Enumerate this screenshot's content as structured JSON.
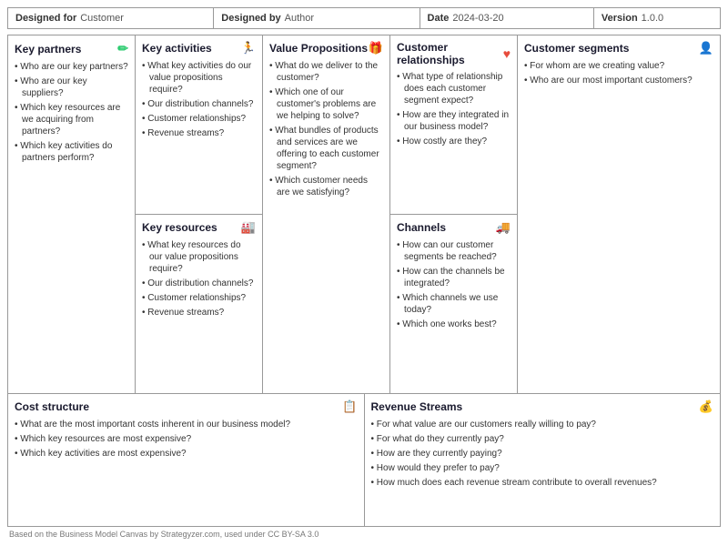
{
  "header": {
    "designed_for_label": "Designed for",
    "designed_for_value": "Customer",
    "designed_by_label": "Designed by",
    "designed_by_value": "Author",
    "date_label": "Date",
    "date_value": "2024-03-20",
    "version_label": "Version",
    "version_value": "1.0.0"
  },
  "sections": {
    "key_partners": {
      "title": "Key partners",
      "icon": "✏",
      "icon_color": "green",
      "bullets": [
        "Who are our key partners?",
        "Who are our key suppliers?",
        "Which key resources are we acquiring from partners?",
        "Which key activities do partners perform?"
      ]
    },
    "key_activities": {
      "title": "Key activities",
      "icon": "🏃",
      "icon_color": "blue-dark",
      "bullets": [
        "What key activities do our value propositions require?",
        "Our distribution channels?",
        "Customer relationships?",
        "Revenue streams?"
      ]
    },
    "key_resources": {
      "title": "Key resources",
      "icon": "🏭",
      "icon_color": "blue-dark",
      "bullets": [
        "What key resources do our value propositions require?",
        "Our distribution channels?",
        "Customer relationships?",
        "Revenue streams?"
      ]
    },
    "value_propositions": {
      "title": "Value Propositions",
      "icon": "🎁",
      "icon_color": "blue-dark",
      "bullets": [
        "What do we deliver to the customer?",
        "Which one of our customer's problems are we helping to solve?",
        "What bundles of products and services are we offering to each customer segment?",
        "Which customer needs are we satisfying?"
      ]
    },
    "customer_relationships": {
      "title": "Customer relationships",
      "icon": "♥",
      "icon_color": "red",
      "bullets": [
        "What type of relationship does each customer segment expect?",
        "How are they integrated in our business model?",
        "How costly are they?"
      ]
    },
    "channels": {
      "title": "Channels",
      "icon": "🚚",
      "icon_color": "blue-truck",
      "bullets": [
        "How can our customer segments be reached?",
        "How can the channels be integrated?",
        "Which channels we use today?",
        "Which one works best?"
      ]
    },
    "customer_segments": {
      "title": "Customer segments",
      "icon": "👤",
      "icon_color": "blue-dark",
      "bullets": [
        "For whom are we creating value?",
        "Who are our most important customers?"
      ]
    },
    "cost_structure": {
      "title": "Cost structure",
      "icon": "📋",
      "icon_color": "teal",
      "bullets": [
        "What are the most important costs inherent in our business model?",
        "Which key resources are most expensive?",
        "Which key activities are most expensive?"
      ]
    },
    "revenue_streams": {
      "title": "Revenue Streams",
      "icon": "💰",
      "icon_color": "orange",
      "bullets": [
        "For what value are our customers really willing to pay?",
        "For what do they currently pay?",
        "How are they currently paying?",
        "How would they prefer to pay?",
        "How much does each revenue stream contribute to overall revenues?"
      ]
    }
  },
  "footer": {
    "text": "Based on the Business Model Canvas by Strategyzer.com, used under CC BY-SA 3.0"
  }
}
